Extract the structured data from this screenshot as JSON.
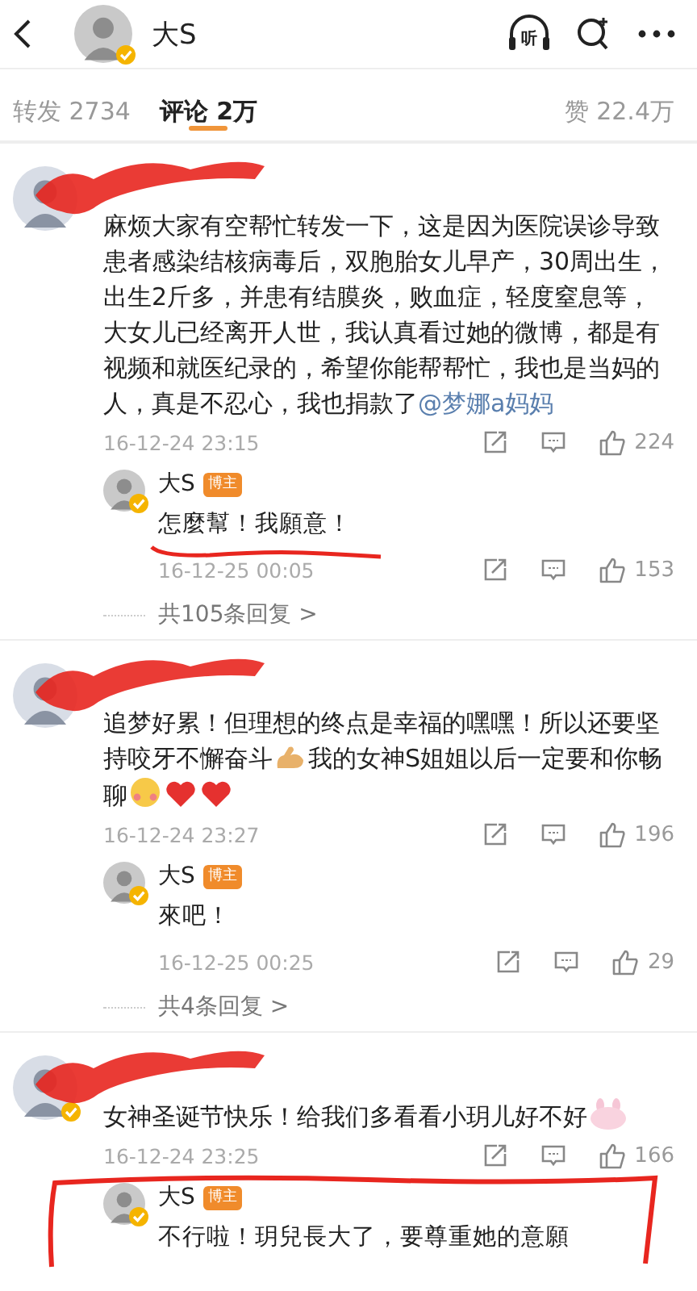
{
  "header": {
    "name": "大S",
    "verified": true,
    "listen_label": "听"
  },
  "tabs": [
    {
      "label": "转发",
      "count": "2734",
      "selected": false
    },
    {
      "label": "评论",
      "count": "2万",
      "selected": true
    },
    {
      "label": "赞",
      "count": "22.4万",
      "selected": false
    }
  ],
  "comments": [
    {
      "avatar_verified": false,
      "scribbled": true,
      "segments": [
        {
          "kind": "text",
          "text": "麻烦大家有空帮忙转发一下，这是因为医院误诊导致患者感染结核病毒后，双胞胎女儿早产，30周出生，出生2斤多，并患有结膜炎，败血症，轻度窒息等，大女儿已经离开人世，我认真看过她的微博，都是有视频和就医纪录的，希望你能帮帮忙，我也是当妈的人，真是不忍心，我也捐款了"
        },
        {
          "kind": "mention",
          "text": "@梦娜a妈妈"
        }
      ],
      "time": "16-12-24 23:15",
      "likes": "224",
      "reply": {
        "name": "大S",
        "badge": "博主",
        "verified": true,
        "underlined": true,
        "text": "怎麼幫！我願意！",
        "time": "16-12-25 00:05",
        "likes": "153"
      },
      "more": "共105条回复 >"
    },
    {
      "avatar_verified": false,
      "scribbled": true,
      "segments": [
        {
          "kind": "text",
          "text": "追梦好累！但理想的终点是幸福的嘿嘿！所以还要坚持咬牙不懈奋斗"
        },
        {
          "kind": "muscle"
        },
        {
          "kind": "text",
          "text": "我的女神S姐姐以后一定要和你畅聊"
        },
        {
          "kind": "blush"
        },
        {
          "kind": "heart"
        },
        {
          "kind": "heart"
        }
      ],
      "time": "16-12-24 23:27",
      "likes": "196",
      "reply": {
        "name": "大S",
        "badge": "博主",
        "verified": true,
        "text": "來吧！",
        "time": "16-12-25 00:25",
        "likes": "29"
      },
      "more": "共4条回复 >"
    },
    {
      "avatar_verified": true,
      "scribbled": true,
      "segments": [
        {
          "kind": "text",
          "text": "女神圣诞节快乐！给我们多看看小玥儿好不好"
        },
        {
          "kind": "bunny"
        }
      ],
      "time": "16-12-24 23:25",
      "likes": "166",
      "reply": {
        "name": "大S",
        "badge": "博主",
        "verified": true,
        "framed": true,
        "text": "不行啦！玥兒長大了，要尊重她的意願"
      }
    }
  ]
}
